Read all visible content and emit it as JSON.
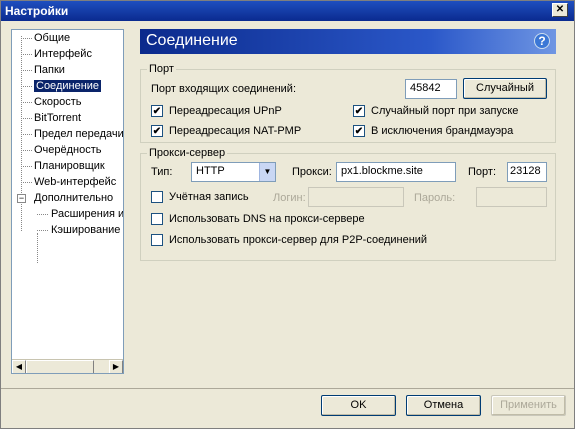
{
  "window": {
    "title": "Настройки",
    "close_icon": "close-icon"
  },
  "sidebar": {
    "items": [
      {
        "label": "Общие"
      },
      {
        "label": "Интерфейс"
      },
      {
        "label": "Папки"
      },
      {
        "label": "Соединение"
      },
      {
        "label": "Скорость"
      },
      {
        "label": "BitTorrent"
      },
      {
        "label": "Предел передачи"
      },
      {
        "label": "Очерёдность"
      },
      {
        "label": "Планировщик"
      },
      {
        "label": "Web-интерфейс"
      },
      {
        "label": "Дополнительно"
      },
      {
        "label": "Расширения и"
      },
      {
        "label": "Кэширование"
      }
    ],
    "selected": "Соединение",
    "expander": "−"
  },
  "header": {
    "title": "Соединение",
    "help": "?"
  },
  "port": {
    "legend": "Порт",
    "incoming_label": "Порт входящих соединений:",
    "incoming_value": "45842",
    "random_button": "Случайный",
    "upnp": {
      "label": "Переадресация UPnP",
      "checked": true
    },
    "natpmp": {
      "label": "Переадресация NAT-PMP",
      "checked": true
    },
    "random_on_start": {
      "label": "Случайный порт при запуске",
      "checked": true
    },
    "firewall": {
      "label": "В исключения брандмауэра",
      "checked": true
    }
  },
  "proxy": {
    "legend": "Прокси-сервер",
    "type_label": "Тип:",
    "type_value": "HTTP",
    "proxy_label": "Прокси:",
    "proxy_value": "px1.blockme.site",
    "port_label": "Порт:",
    "port_value": "23128",
    "auth": {
      "label": "Учётная запись",
      "checked": false
    },
    "login_label": "Логин:",
    "password_label": "Пароль:",
    "dns": {
      "label": "Использовать DNS на прокси-сервере",
      "checked": false
    },
    "p2p": {
      "label": "Использовать прокси-сервер для P2P-соединений",
      "checked": false
    }
  },
  "footer": {
    "ok": "OK",
    "cancel": "Отмена",
    "apply": "Применить"
  }
}
